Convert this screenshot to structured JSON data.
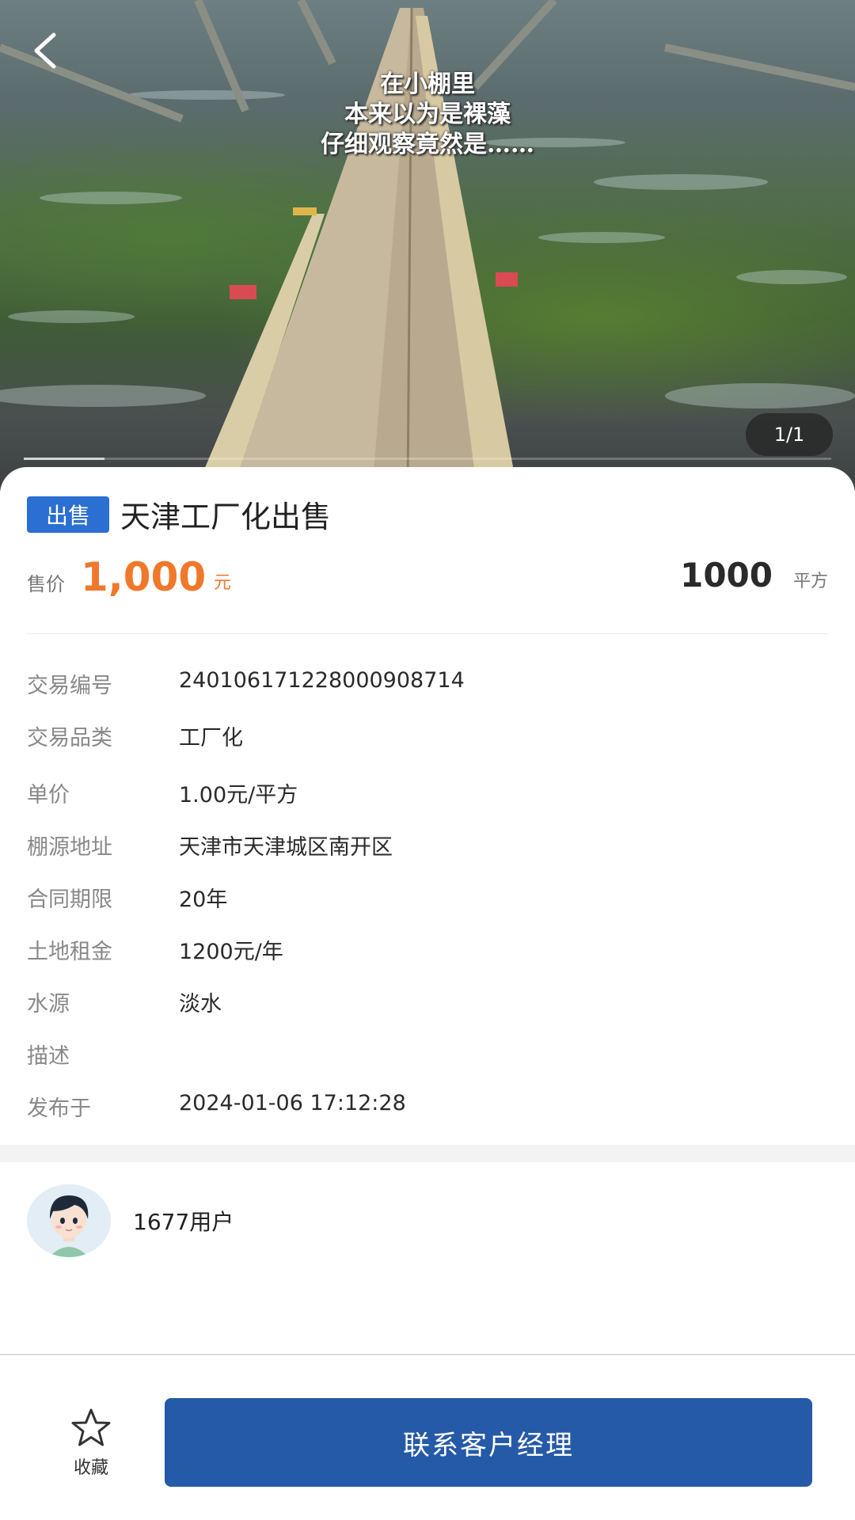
{
  "hero": {
    "overlay_lines": [
      "在小棚里",
      "本来以为是裸藻",
      "仔细观察竟然是……"
    ],
    "counter": "1/1",
    "progress": 0.1
  },
  "listing": {
    "badge": "出售",
    "title": "天津工厂化出售",
    "price_label": "售价",
    "price_value": "1,000",
    "price_unit": "元",
    "area_value": "1000",
    "area_unit": "平方"
  },
  "info": [
    {
      "key": "交易编号",
      "value": "24010617122800090871​4"
    },
    {
      "key": "交易品类",
      "value": "工厂化"
    },
    {
      "key": "单价",
      "value": "1.00元/平方"
    },
    {
      "key": "棚源地址",
      "value": "天津市天津城区南开区"
    },
    {
      "key": "合同期限",
      "value": "20年"
    },
    {
      "key": "土地租金",
      "value": "1200元/年"
    },
    {
      "key": "水源",
      "value": "淡水"
    },
    {
      "key": "描述",
      "value": ""
    },
    {
      "key": "发布于",
      "value": "2024-01-06 17:12:28"
    }
  ],
  "user": {
    "name": "1677用户"
  },
  "bottom": {
    "favorite_label": "收藏",
    "contact_label": "联系客户经理"
  },
  "icons": {
    "back": "back-arrow-icon",
    "favorite": "star-icon"
  }
}
